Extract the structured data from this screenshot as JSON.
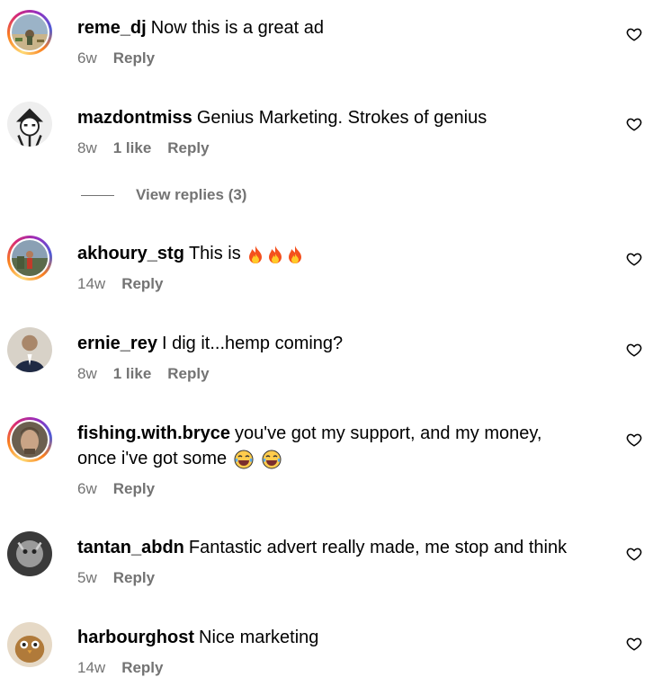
{
  "comments": [
    {
      "username": "reme_dj",
      "text": "Now this is a great ad",
      "time": "6w",
      "likes": "",
      "reply": "Reply"
    },
    {
      "username": "mazdontmiss",
      "text": "Genius Marketing. Strokes of genius",
      "time": "8w",
      "likes": "1 like",
      "reply": "Reply"
    },
    {
      "username": "akhoury_stg",
      "text": "This is",
      "time": "14w",
      "likes": "",
      "reply": "Reply",
      "emojis": [
        "fire",
        "fire",
        "fire"
      ]
    },
    {
      "username": "ernie_rey",
      "text": "I dig it...hemp coming?",
      "time": "8w",
      "likes": "1 like",
      "reply": "Reply"
    },
    {
      "username": "fishing.with.bryce",
      "text": "you've got my support, and my money,",
      "text2": "once i've got some",
      "time": "6w",
      "likes": "",
      "reply": "Reply",
      "emojis": [
        "laughing-tears",
        "laughing-tears"
      ]
    },
    {
      "username": "tantan_abdn",
      "text": "Fantastic advert really made, me stop and think",
      "time": "5w",
      "likes": "",
      "reply": "Reply"
    },
    {
      "username": "harbourghost",
      "text": "Nice marketing",
      "time": "14w",
      "likes": "",
      "reply": "Reply"
    }
  ],
  "view_replies": "View replies (3)",
  "icons": {
    "like": "heart-outline-icon",
    "fire": "fire-emoji",
    "laugh": "tears-of-joy-emoji"
  },
  "colors": {
    "meta": "#737373",
    "text": "#000000"
  }
}
